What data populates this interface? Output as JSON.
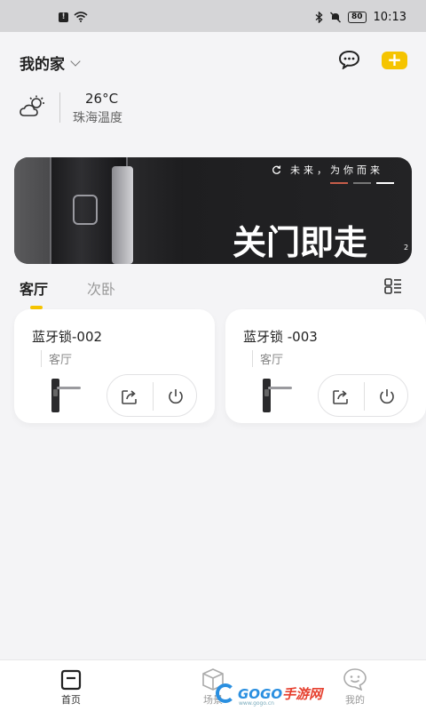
{
  "status_bar": {
    "time": "10:13",
    "battery": "80"
  },
  "header": {
    "home_name": "我的家"
  },
  "weather": {
    "temperature": "26°C",
    "location_label": "珠海温度"
  },
  "banner": {
    "tagline": "未来，为你而来",
    "headline": "关门即走",
    "page_number": "2"
  },
  "room_tabs": [
    {
      "label": "客厅",
      "active": true
    },
    {
      "label": "次卧",
      "active": false
    }
  ],
  "devices": [
    {
      "name": "蓝牙锁-002",
      "room": "客厅"
    },
    {
      "name": "蓝牙锁 -003",
      "room": "客厅"
    }
  ],
  "bottom_nav": {
    "home": "首页",
    "scene": "场景",
    "mine": "我的"
  },
  "watermark": {
    "brand_prefix": "GOGO",
    "brand_suffix": "手游网",
    "url": "www.gogo.cn"
  },
  "colors": {
    "accent": "#f5c400",
    "background": "#f4f4f6"
  }
}
